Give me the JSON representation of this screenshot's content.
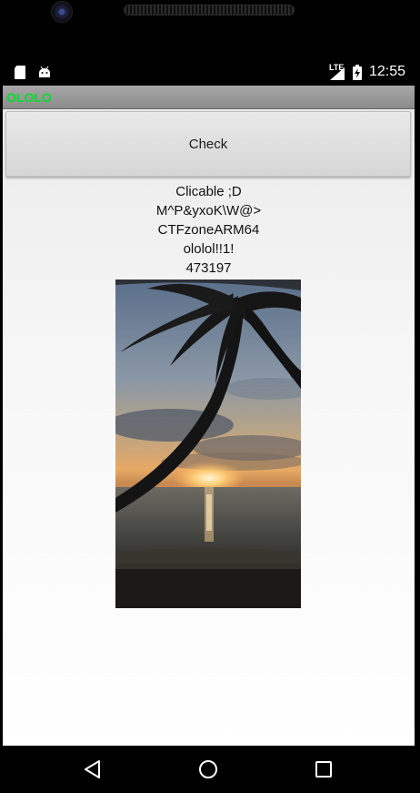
{
  "status_bar": {
    "network_label": "LTE",
    "time": "12:55"
  },
  "app": {
    "title": "OLOLO",
    "title_color": "#00e02a",
    "check_button_label": "Check",
    "info_lines": [
      "Clicable ;D",
      "M^P&yxoK\\W@>",
      "CTFzoneARM64",
      "ololol!!1!",
      "473197"
    ],
    "image": "sunset-palm-beach-photo"
  },
  "nav_bar": {
    "buttons": [
      "back-icon",
      "home-icon",
      "recents-icon"
    ]
  }
}
